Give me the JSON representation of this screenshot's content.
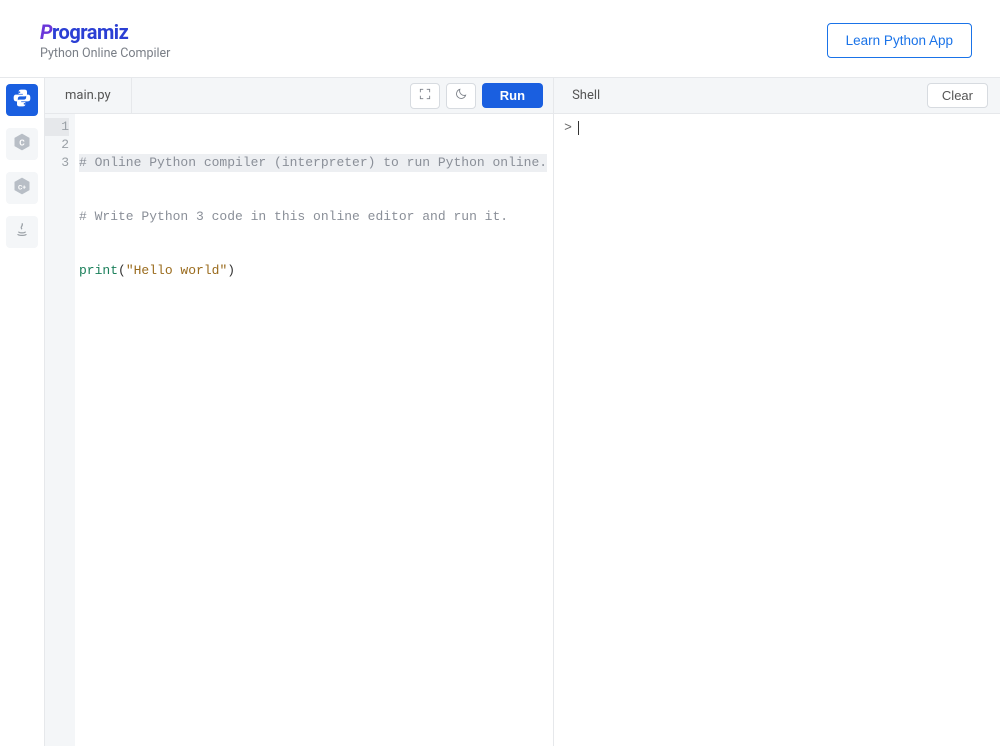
{
  "header": {
    "brand_name": "rogramiz",
    "brand_prefix": "P",
    "subtitle": "Python Online Compiler",
    "learn_button": "Learn Python App"
  },
  "sidebar": {
    "languages": [
      "python",
      "c",
      "cpp",
      "java"
    ],
    "active": "python"
  },
  "editor": {
    "tab_label": "main.py",
    "run_label": "Run",
    "lines": [
      {
        "n": "1",
        "type": "comment",
        "text": "# Online Python compiler (interpreter) to run Python online."
      },
      {
        "n": "2",
        "type": "comment",
        "text": "# Write Python 3 code in this online editor and run it."
      },
      {
        "n": "3",
        "type": "print",
        "func": "print",
        "open": "(",
        "string": "\"Hello world\"",
        "close": ")"
      }
    ]
  },
  "shell": {
    "label": "Shell",
    "clear_label": "Clear",
    "prompt": ">"
  }
}
